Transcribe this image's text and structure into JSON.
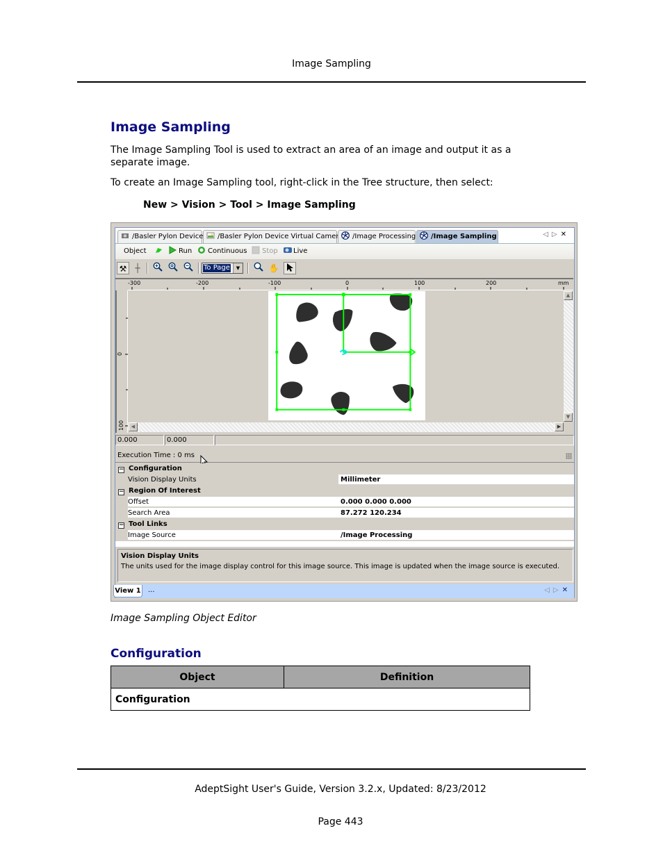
{
  "page": {
    "running_header": "Image Sampling",
    "title": "Image Sampling",
    "intro": "The Image Sampling Tool is used to extract an area of an image and output it as a separate image.",
    "create_instruction": "To create an Image Sampling tool, right-click in the Tree structure, then select:",
    "menu_path": "New > Vision > Tool > Image Sampling",
    "figure_caption": "Image Sampling Object Editor",
    "section_title": "Configuration",
    "table": {
      "headers": [
        "Object",
        "Definition"
      ],
      "rows": [
        [
          "Configuration",
          ""
        ]
      ]
    },
    "footer": "AdeptSight User's Guide,  Version 3.2.x, Updated: 8/23/2012",
    "page_number": "Page 443"
  },
  "app": {
    "tabs": [
      {
        "label": "/Basler Pylon Device",
        "icon": "camera-icon",
        "active": false
      },
      {
        "label": "/Basler Pylon Device Virtual Camera",
        "icon": "image-icon",
        "active": false
      },
      {
        "label": "/Image Processing",
        "icon": "aperture-icon",
        "active": false
      },
      {
        "label": "/Image Sampling",
        "icon": "aperture-icon",
        "active": true
      }
    ],
    "tab_nav": {
      "prev": "◁",
      "next": "▷",
      "close": "✕"
    },
    "toolbar": {
      "object_label": "Object",
      "run_label": "Run",
      "continuous_label": "Continuous",
      "stop_label": "Stop",
      "live_label": "Live"
    },
    "zoom_select": {
      "value": "To Page"
    },
    "ruler": {
      "x_ticks": [
        "-300",
        "-200",
        "-100",
        "0",
        "100",
        "200"
      ],
      "unit": "mm",
      "y_ticks": [
        "0",
        "100"
      ]
    },
    "coordinates": {
      "x": "0.000",
      "y": "0.000"
    },
    "execution_time": "Execution Time : 0 ms",
    "properties": [
      {
        "type": "category",
        "label": "Configuration"
      },
      {
        "type": "item",
        "label": "Vision Display Units",
        "value": "Millimeter"
      },
      {
        "type": "category",
        "label": "Region Of Interest"
      },
      {
        "type": "item",
        "label": "Offset",
        "value": "0.000 0.000 0.000"
      },
      {
        "type": "item",
        "label": "Search Area",
        "value": "87.272 120.234"
      },
      {
        "type": "category",
        "label": "Tool Links"
      },
      {
        "type": "item",
        "label": "Image Source",
        "value": "/Image Processing"
      }
    ],
    "description": {
      "title": "Vision Display Units",
      "text": "The units used for the image display control for this image source. This image is updated when the image source is executed."
    },
    "view_tab": "View 1",
    "view_more": "..."
  }
}
